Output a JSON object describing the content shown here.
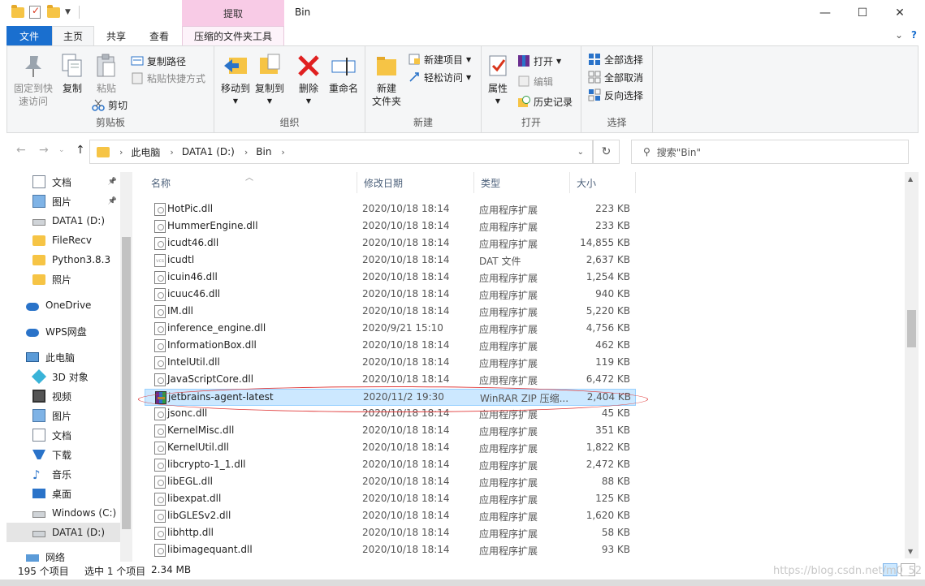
{
  "window": {
    "title": "Bin",
    "context_tab_header": "提取",
    "minimize": "—",
    "maximize": "☐",
    "close": "✕"
  },
  "tabs": {
    "file": "文件",
    "home": "主页",
    "share": "共享",
    "view": "查看",
    "ctx_tools": "压缩的文件夹工具"
  },
  "ribbon": {
    "clipboard": {
      "label": "剪贴板",
      "pin_quick": "固定到快\n速访问",
      "copy": "复制",
      "paste": "粘贴",
      "copy_path": "复制路径",
      "paste_shortcut": "粘贴快捷方式",
      "cut": "剪切"
    },
    "organize": {
      "label": "组织",
      "move_to": "移动到",
      "copy_to": "复制到",
      "delete": "删除",
      "rename": "重命名"
    },
    "new": {
      "label": "新建",
      "new_folder": "新建\n文件夹",
      "new_item": "新建项目",
      "easy_access": "轻松访问"
    },
    "open": {
      "label": "打开",
      "properties": "属性",
      "open": "打开",
      "edit": "编辑",
      "history": "历史记录"
    },
    "select": {
      "label": "选择",
      "select_all": "全部选择",
      "select_none": "全部取消",
      "invert": "反向选择"
    }
  },
  "address": {
    "crumbs": [
      "此电脑",
      "DATA1 (D:)",
      "Bin"
    ],
    "search_placeholder": "搜索\"Bin\""
  },
  "nav": {
    "items": [
      {
        "label": "文档",
        "icon": "document-icon",
        "pinned": true
      },
      {
        "label": "图片",
        "icon": "pictures-icon",
        "pinned": true
      },
      {
        "label": "DATA1 (D:)",
        "icon": "drive-icon",
        "pinned": false
      },
      {
        "label": "FileRecv",
        "icon": "folder-icon",
        "pinned": false
      },
      {
        "label": "Python3.8.3",
        "icon": "folder-icon",
        "pinned": false
      },
      {
        "label": "照片",
        "icon": "folder-icon",
        "pinned": false
      },
      {
        "label": "OneDrive",
        "icon": "cloud-icon",
        "pinned": false
      },
      {
        "label": "WPS网盘",
        "icon": "cloud-icon",
        "pinned": false
      },
      {
        "label": "此电脑",
        "icon": "computer-icon",
        "pinned": false
      },
      {
        "label": "3D 对象",
        "icon": "cube-icon",
        "pinned": false
      },
      {
        "label": "视频",
        "icon": "video-icon",
        "pinned": false
      },
      {
        "label": "图片",
        "icon": "pictures-icon",
        "pinned": false
      },
      {
        "label": "文档",
        "icon": "document-icon",
        "pinned": false
      },
      {
        "label": "下载",
        "icon": "download-icon",
        "pinned": false
      },
      {
        "label": "音乐",
        "icon": "music-icon",
        "pinned": false
      },
      {
        "label": "桌面",
        "icon": "desktop-icon",
        "pinned": false
      },
      {
        "label": "Windows (C:)",
        "icon": "drive-icon",
        "pinned": false
      },
      {
        "label": "DATA1 (D:)",
        "icon": "drive-icon",
        "pinned": false
      },
      {
        "label": "网络",
        "icon": "network-icon",
        "pinned": false
      }
    ]
  },
  "columns": {
    "name": "名称",
    "date": "修改日期",
    "type": "类型",
    "size": "大小"
  },
  "files": [
    {
      "name": "HotPic.dll",
      "date": "2020/10/18 18:14",
      "type": "应用程序扩展",
      "size": "223 KB",
      "kind": "dll"
    },
    {
      "name": "HummerEngine.dll",
      "date": "2020/10/18 18:14",
      "type": "应用程序扩展",
      "size": "233 KB",
      "kind": "dll"
    },
    {
      "name": "icudt46.dll",
      "date": "2020/10/18 18:14",
      "type": "应用程序扩展",
      "size": "14,855 KB",
      "kind": "dll"
    },
    {
      "name": "icudtl",
      "date": "2020/10/18 18:14",
      "type": "DAT 文件",
      "size": "2,637 KB",
      "kind": "dat"
    },
    {
      "name": "icuin46.dll",
      "date": "2020/10/18 18:14",
      "type": "应用程序扩展",
      "size": "1,254 KB",
      "kind": "dll"
    },
    {
      "name": "icuuc46.dll",
      "date": "2020/10/18 18:14",
      "type": "应用程序扩展",
      "size": "940 KB",
      "kind": "dll"
    },
    {
      "name": "IM.dll",
      "date": "2020/10/18 18:14",
      "type": "应用程序扩展",
      "size": "5,220 KB",
      "kind": "dll"
    },
    {
      "name": "inference_engine.dll",
      "date": "2020/9/21 15:10",
      "type": "应用程序扩展",
      "size": "4,756 KB",
      "kind": "dll"
    },
    {
      "name": "InformationBox.dll",
      "date": "2020/10/18 18:14",
      "type": "应用程序扩展",
      "size": "462 KB",
      "kind": "dll"
    },
    {
      "name": "IntelUtil.dll",
      "date": "2020/10/18 18:14",
      "type": "应用程序扩展",
      "size": "119 KB",
      "kind": "dll"
    },
    {
      "name": "JavaScriptCore.dll",
      "date": "2020/10/18 18:14",
      "type": "应用程序扩展",
      "size": "6,472 KB",
      "kind": "dll"
    },
    {
      "name": "jetbrains-agent-latest",
      "date": "2020/11/2 19:30",
      "type": "WinRAR ZIP 压缩...",
      "size": "2,404 KB",
      "kind": "rar",
      "selected": true
    },
    {
      "name": "jsonc.dll",
      "date": "2020/10/18 18:14",
      "type": "应用程序扩展",
      "size": "45 KB",
      "kind": "dll"
    },
    {
      "name": "KernelMisc.dll",
      "date": "2020/10/18 18:14",
      "type": "应用程序扩展",
      "size": "351 KB",
      "kind": "dll"
    },
    {
      "name": "KernelUtil.dll",
      "date": "2020/10/18 18:14",
      "type": "应用程序扩展",
      "size": "1,822 KB",
      "kind": "dll"
    },
    {
      "name": "libcrypto-1_1.dll",
      "date": "2020/10/18 18:14",
      "type": "应用程序扩展",
      "size": "2,472 KB",
      "kind": "dll"
    },
    {
      "name": "libEGL.dll",
      "date": "2020/10/18 18:14",
      "type": "应用程序扩展",
      "size": "88 KB",
      "kind": "dll"
    },
    {
      "name": "libexpat.dll",
      "date": "2020/10/18 18:14",
      "type": "应用程序扩展",
      "size": "125 KB",
      "kind": "dll"
    },
    {
      "name": "libGLESv2.dll",
      "date": "2020/10/18 18:14",
      "type": "应用程序扩展",
      "size": "1,620 KB",
      "kind": "dll"
    },
    {
      "name": "libhttp.dll",
      "date": "2020/10/18 18:14",
      "type": "应用程序扩展",
      "size": "58 KB",
      "kind": "dll"
    },
    {
      "name": "libimagequant.dll",
      "date": "2020/10/18 18:14",
      "type": "应用程序扩展",
      "size": "93 KB",
      "kind": "dll"
    }
  ],
  "status": {
    "count": "195 个项目",
    "selected": "选中 1 个项目",
    "size": "2.34 MB"
  },
  "watermark": "https://blog.csdn.net/m0_52"
}
